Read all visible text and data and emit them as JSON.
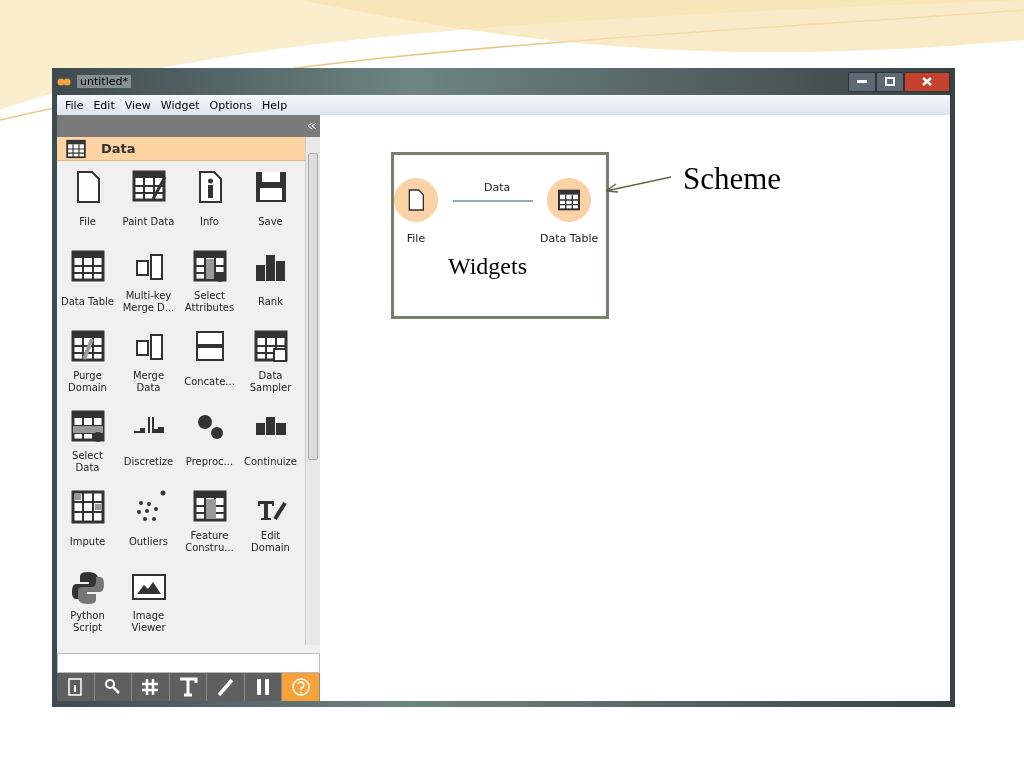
{
  "window": {
    "title": "untitled*"
  },
  "menu": [
    "File",
    "Edit",
    "View",
    "Widget",
    "Options",
    "Help"
  ],
  "category": {
    "title": "Data"
  },
  "widgets": [
    {
      "label": "File"
    },
    {
      "label": "Paint Data"
    },
    {
      "label": "Info"
    },
    {
      "label": "Save"
    },
    {
      "label": "Data Table"
    },
    {
      "label": "Multi-key Merge D..."
    },
    {
      "label": "Select Attributes"
    },
    {
      "label": "Rank"
    },
    {
      "label": "Purge Domain"
    },
    {
      "label": "Merge Data"
    },
    {
      "label": "Concate..."
    },
    {
      "label": "Data Sampler"
    },
    {
      "label": "Select Data"
    },
    {
      "label": "Discretize"
    },
    {
      "label": "Preproc..."
    },
    {
      "label": "Continuize"
    },
    {
      "label": "Impute"
    },
    {
      "label": "Outliers"
    },
    {
      "label": "Feature Constru..."
    },
    {
      "label": "Edit Domain"
    },
    {
      "label": "Python Script"
    },
    {
      "label": "Image Viewer"
    }
  ],
  "toolbar": [
    {
      "selected": false
    },
    {
      "selected": false
    },
    {
      "selected": false
    },
    {
      "selected": false
    },
    {
      "selected": false
    },
    {
      "selected": false
    },
    {
      "selected": true
    }
  ],
  "canvas": {
    "nodes": [
      {
        "label": "File"
      },
      {
        "label": "Data Table"
      }
    ],
    "link": {
      "label": "Data"
    }
  },
  "annotations": {
    "widgets": "Widgets",
    "scheme": "Scheme"
  }
}
